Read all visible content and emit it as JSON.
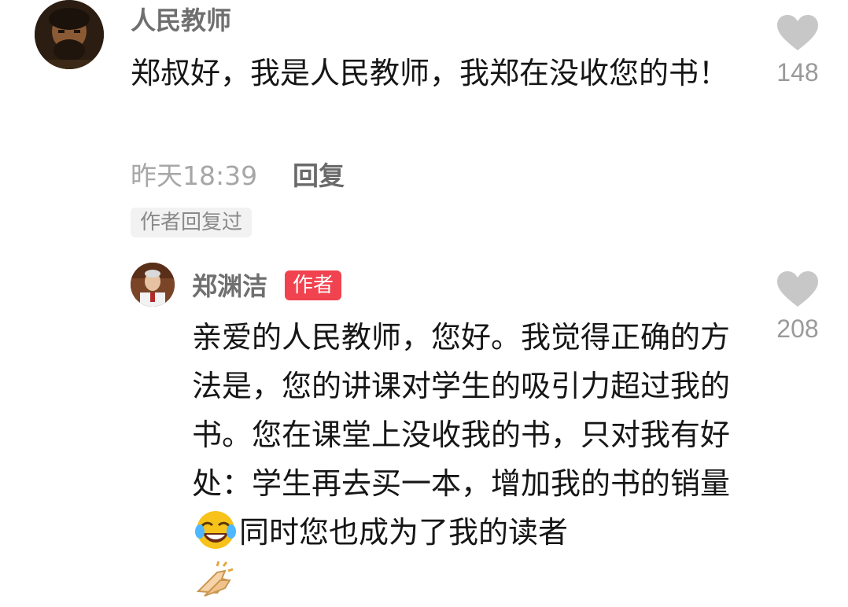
{
  "comments": [
    {
      "author": "人民教师",
      "text": "郑叔好，我是人民教师，我郑在没收您的书！",
      "time": "昨天18:39",
      "reply_label": "回复",
      "author_replied_tag": "作者回复过",
      "likes": "148",
      "icons": [
        "heart-icon"
      ]
    }
  ],
  "reply": {
    "author": "郑渊洁",
    "author_badge": "作者",
    "text_part1": "亲爱的人民教师，您好。我觉得正确的方法是，您的讲课对学生的吸引力超过我的书。您在课堂上没收我的书，只对我有好处：学生再去买一本，增加我的书的销量",
    "text_part2": "同时您也成为了我的读者",
    "emojis": [
      "laughing-crying-face-emoji",
      "clapping-hands-emoji"
    ],
    "likes": "208",
    "icons": [
      "heart-icon"
    ]
  },
  "colors": {
    "name_gray": "#6f6f6f",
    "time_gray": "#a7a7a7",
    "badge_red": "#f0434f",
    "heart_gray": "#c7c7c7"
  }
}
